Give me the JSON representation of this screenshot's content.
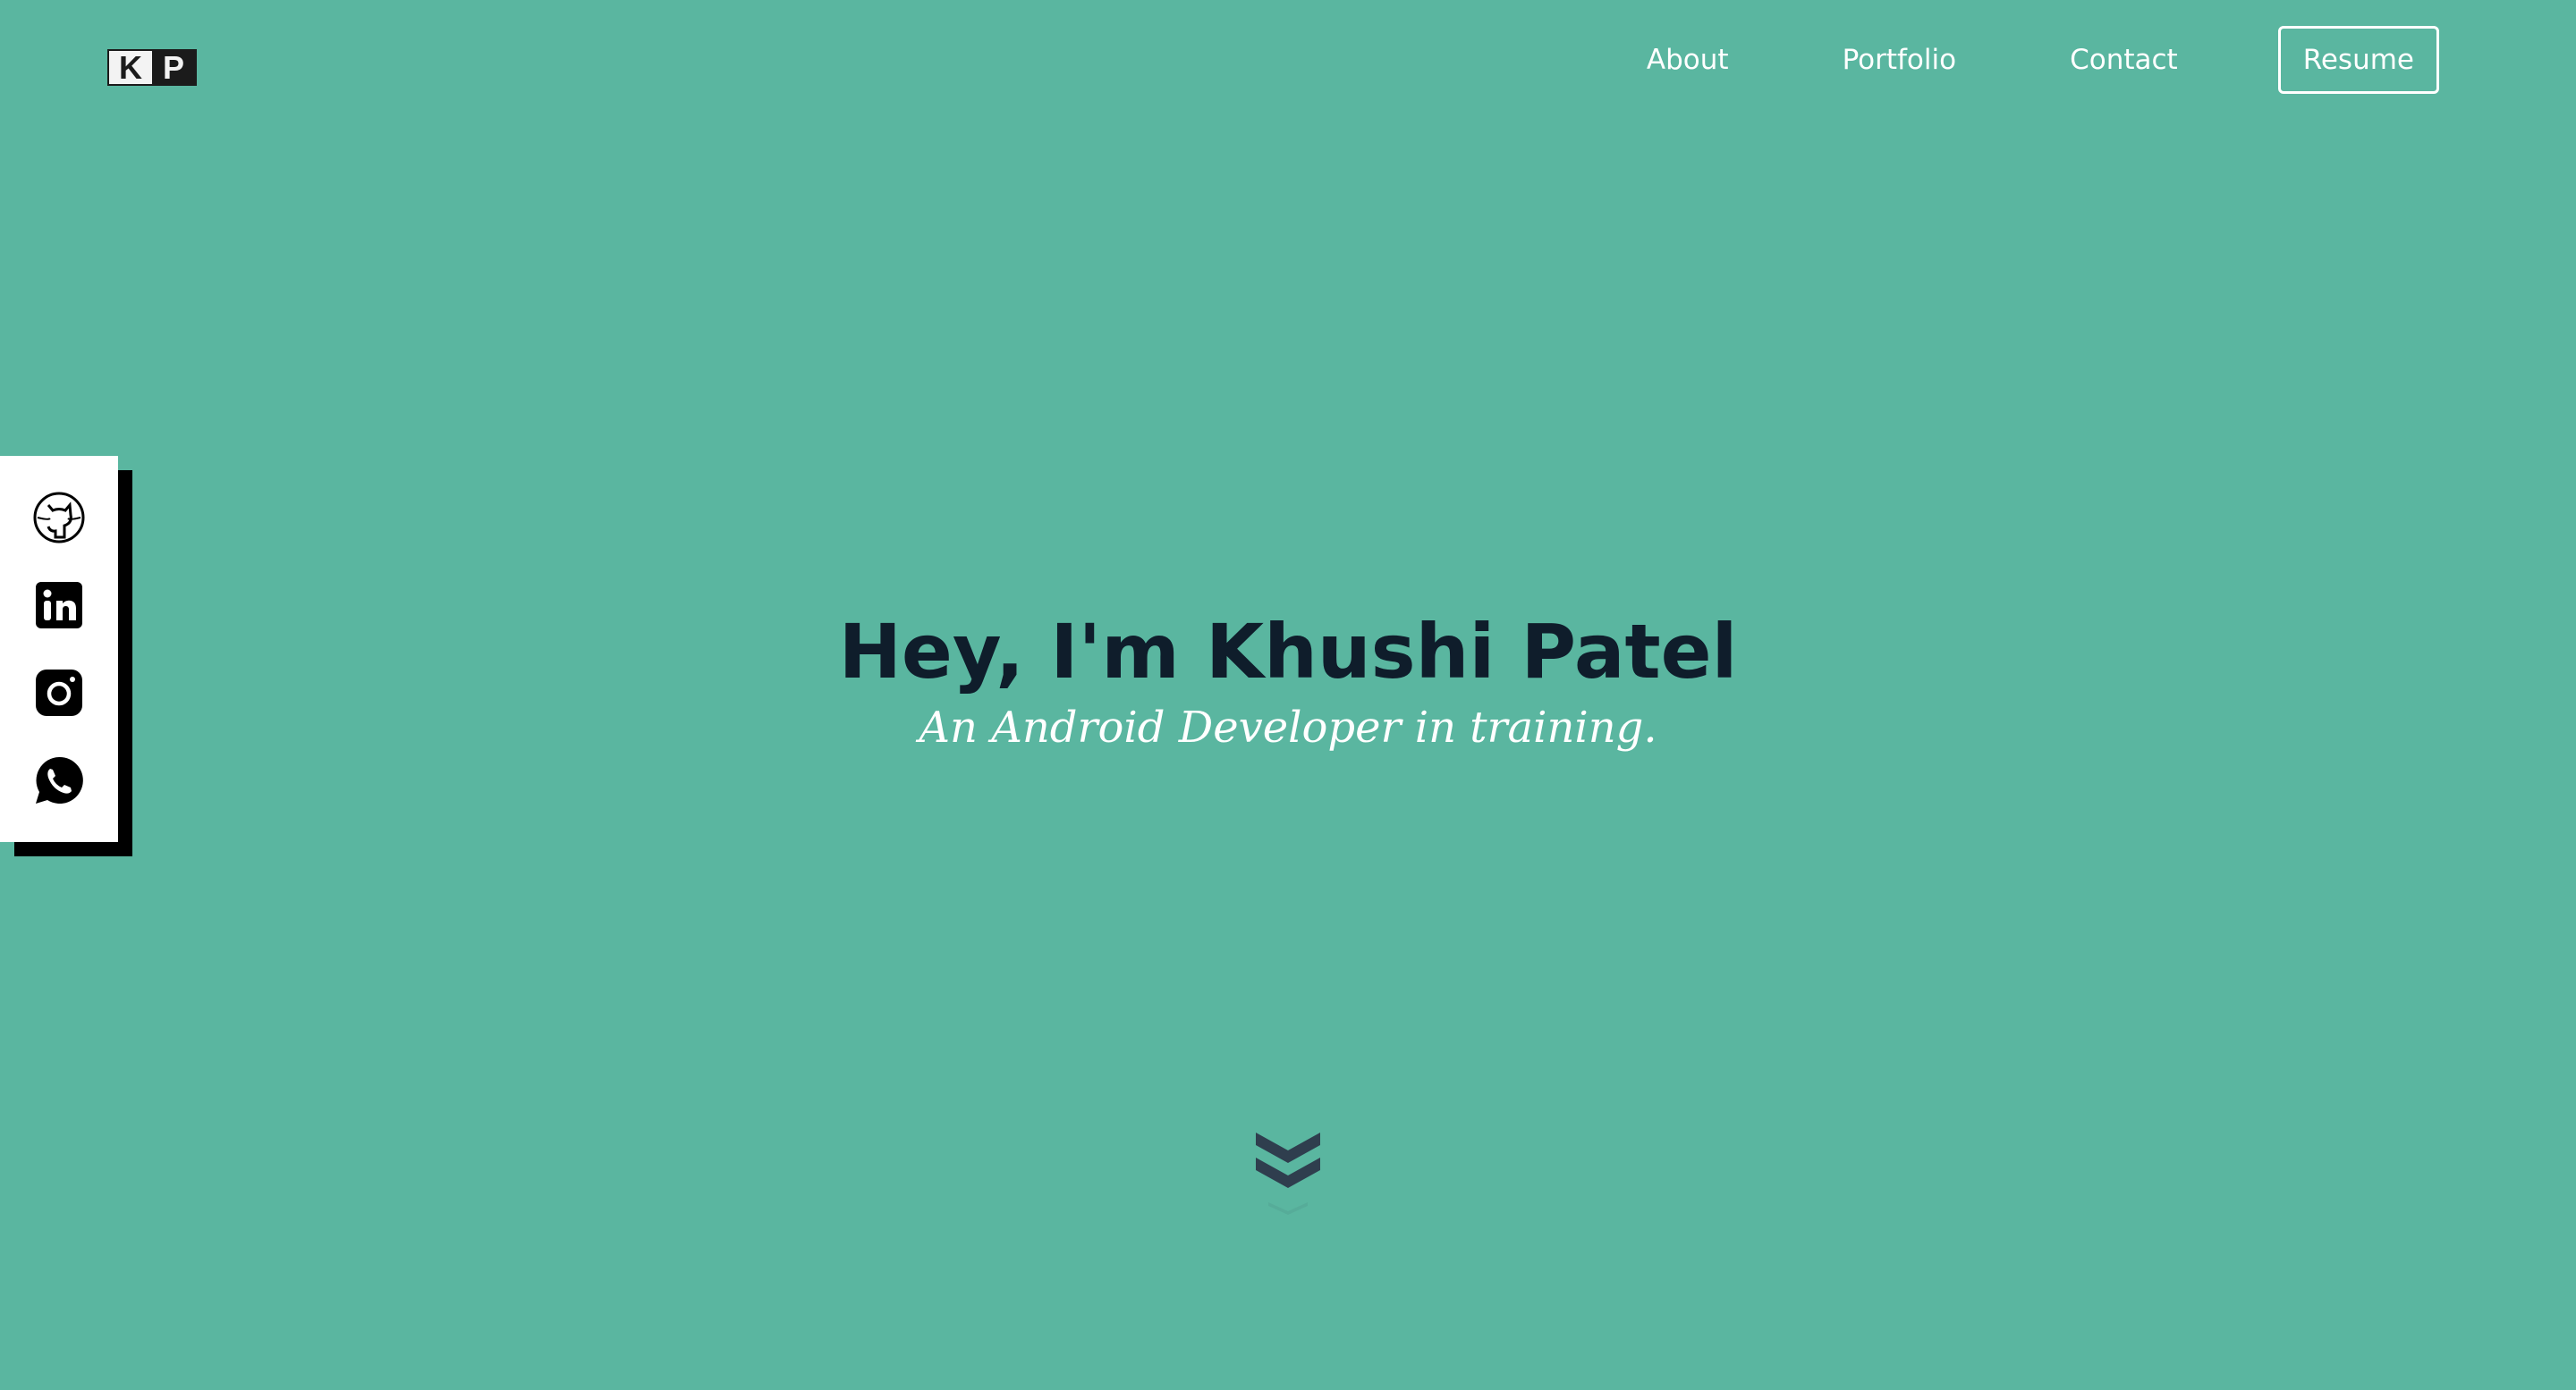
{
  "logo": {
    "k": "K",
    "p": "P"
  },
  "nav": {
    "items": [
      {
        "label": "About"
      },
      {
        "label": "Portfolio"
      },
      {
        "label": "Contact"
      }
    ],
    "resume_label": "Resume"
  },
  "social": {
    "icons": [
      "github-icon",
      "linkedin-icon",
      "instagram-icon",
      "whatsapp-icon"
    ]
  },
  "hero": {
    "title": "Hey, I'm Khushi Patel",
    "subtitle": "An Android Developer in training."
  },
  "colors": {
    "background": "#5ab6a0",
    "heading": "#0f1d2b",
    "chevron": "#2f3e4e"
  }
}
